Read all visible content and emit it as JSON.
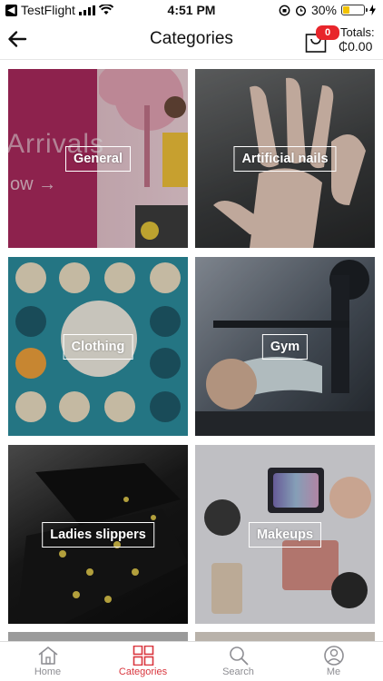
{
  "status_bar": {
    "back_app": "TestFlight",
    "time": "4:51 PM",
    "battery_percent": "30%",
    "battery_level": 0.3
  },
  "header": {
    "title": "Categories",
    "cart_count": "0",
    "totals_label": "Totals:",
    "totals_value": "₵0.00"
  },
  "categories": [
    {
      "label": "General"
    },
    {
      "label": "Artificial nails"
    },
    {
      "label": "Clothing"
    },
    {
      "label": "Gym"
    },
    {
      "label": "Ladies slippers"
    },
    {
      "label": "Makeups"
    }
  ],
  "general_banner": {
    "text": "Arrivals",
    "subtext": "ow →"
  },
  "bottom_nav": {
    "items": [
      {
        "label": "Home",
        "icon": "home-icon"
      },
      {
        "label": "Categories",
        "icon": "grid-icon"
      },
      {
        "label": "Search",
        "icon": "search-icon"
      },
      {
        "label": "Me",
        "icon": "user-icon"
      }
    ],
    "active": "Categories"
  },
  "colors": {
    "accent": "#d9363e",
    "badge": "#e8252b"
  }
}
